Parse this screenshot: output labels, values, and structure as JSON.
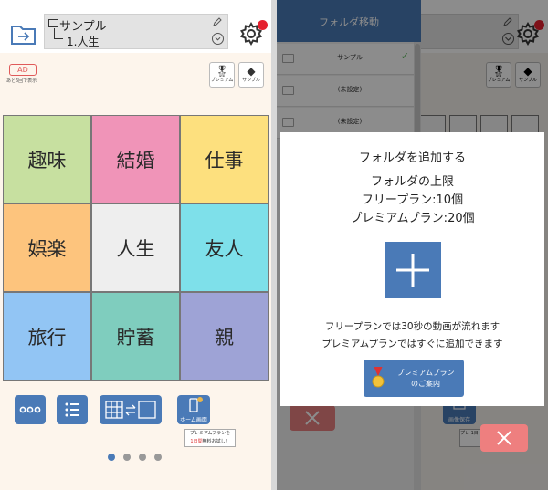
{
  "left": {
    "path": {
      "parent": "サンプル",
      "child": "1.人生"
    },
    "ad": {
      "badge": "AD",
      "note": "あと6回で表示"
    },
    "mini_buttons": [
      {
        "label": "プレミアム"
      },
      {
        "label": "サンプル"
      }
    ],
    "grid": [
      {
        "label": "趣味",
        "color": "#c7e0a0"
      },
      {
        "label": "結婚",
        "color": "#f094b8"
      },
      {
        "label": "仕事",
        "color": "#fde07e"
      },
      {
        "label": "娯楽",
        "color": "#fdc47d"
      },
      {
        "label": "人生",
        "color": "#eeeeee"
      },
      {
        "label": "友人",
        "color": "#7ee0ea"
      },
      {
        "label": "旅行",
        "color": "#92c5f4"
      },
      {
        "label": "貯蓄",
        "color": "#7fcdbe"
      },
      {
        "label": "親",
        "color": "#9ea3d6"
      }
    ],
    "toolbar": {
      "home_label": "ホーム画面"
    },
    "promo": {
      "line1": "プレミアムプランを",
      "line2_red": "1日間",
      "line2_rest": "無料お試し！"
    },
    "pager": {
      "count": 4,
      "active": 1
    }
  },
  "right": {
    "panel": {
      "title": "フォルダ移動",
      "folders": [
        {
          "name": "サンプル",
          "selected": true
        },
        {
          "name": "(未設定)",
          "selected": false
        },
        {
          "name": "(未設定)",
          "selected": false
        }
      ]
    },
    "mini_buttons": [
      {
        "label": "プレミアム"
      },
      {
        "label": "サンプル"
      }
    ],
    "image_save_label": "画像保存",
    "promo_fragment": "プレ 1日",
    "dialog": {
      "title": "フォルダを追加する",
      "limit_title": "フォルダの上限",
      "free_plan": "フリープラン:10個",
      "premium_plan": "プレミアムプラン:20個",
      "note_free": "フリープランでは30秒の動画が流れます",
      "note_premium": "プレミアムプランではすぐに追加できます",
      "premium_button": {
        "line1": "プレミアムプラン",
        "line2": "のご案内"
      }
    }
  },
  "colors": {
    "accent": "#4a7ab7",
    "alert": "#e5202e",
    "close": "#ee7f7f"
  }
}
